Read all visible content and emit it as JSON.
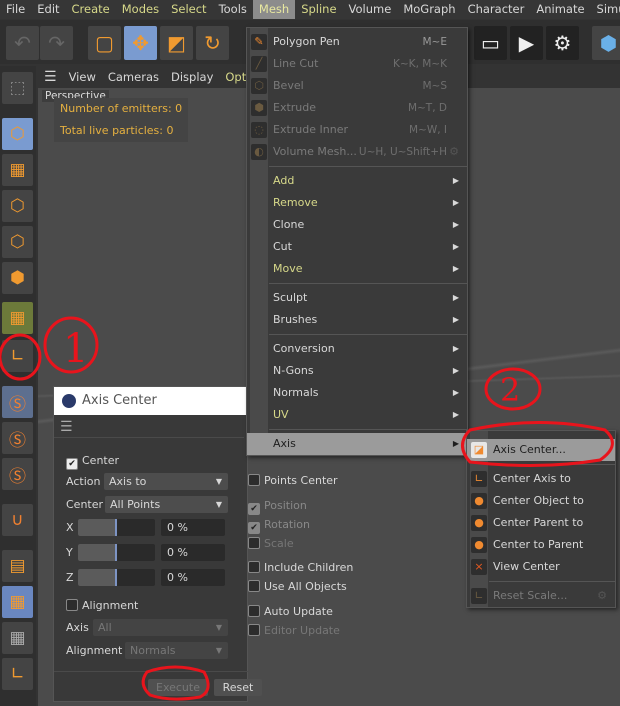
{
  "menubar": [
    {
      "label": "File",
      "yellow": false
    },
    {
      "label": "Edit",
      "yellow": false
    },
    {
      "label": "Create",
      "yellow": true
    },
    {
      "label": "Modes",
      "yellow": true
    },
    {
      "label": "Select",
      "yellow": true
    },
    {
      "label": "Tools",
      "yellow": false
    },
    {
      "label": "Mesh",
      "yellow": true,
      "active": true
    },
    {
      "label": "Spline",
      "yellow": true
    },
    {
      "label": "Volume",
      "yellow": false
    },
    {
      "label": "MoGraph",
      "yellow": false
    },
    {
      "label": "Character",
      "yellow": false
    },
    {
      "label": "Animate",
      "yellow": false
    },
    {
      "label": "Simulate",
      "yellow": false
    }
  ],
  "viewport": {
    "menu": [
      "View",
      "Cameras",
      "Display",
      "Options"
    ],
    "camera": "Perspective",
    "hud": {
      "emitters": "Number of emitters: 0",
      "particles": "Total live particles: 0"
    }
  },
  "mesh_menu": [
    {
      "label": "Polygon Pen",
      "shortcut": "M~E",
      "icon": "polygon-pen-icon"
    },
    {
      "label": "Line Cut",
      "shortcut": "K~K, M~K",
      "disabled": true,
      "icon": "knife-icon"
    },
    {
      "label": "Bevel",
      "shortcut": "M~S",
      "disabled": true,
      "icon": "bevel-icon"
    },
    {
      "label": "Extrude",
      "shortcut": "M~T, D",
      "disabled": true,
      "icon": "extrude-icon"
    },
    {
      "label": "Extrude Inner",
      "shortcut": "M~W, I",
      "disabled": true,
      "icon": "extrude-inner-icon"
    },
    {
      "label": "Volume Mesh...",
      "shortcut": "U~H, U~Shift+H",
      "disabled": true,
      "icon": "volume-mesh-icon",
      "gear": true
    },
    {
      "sep": true
    },
    {
      "label": "Add",
      "sub": true,
      "yellow": true
    },
    {
      "label": "Remove",
      "sub": true,
      "yellow": true
    },
    {
      "label": "Clone",
      "sub": true
    },
    {
      "label": "Cut",
      "sub": true
    },
    {
      "label": "Move",
      "sub": true,
      "yellow": true
    },
    {
      "sep": true
    },
    {
      "label": "Sculpt",
      "sub": true
    },
    {
      "label": "Brushes",
      "sub": true
    },
    {
      "sep": true
    },
    {
      "label": "Conversion",
      "sub": true
    },
    {
      "label": "N-Gons",
      "sub": true
    },
    {
      "label": "Normals",
      "sub": true
    },
    {
      "label": "UV",
      "sub": true,
      "yellow": true
    },
    {
      "sep": true
    },
    {
      "label": "Axis",
      "sub": true,
      "highlight": true
    }
  ],
  "axis_submenu": [
    {
      "label": "Axis Center...",
      "highlight": true,
      "icon": "axis-center-icon"
    },
    {
      "sep": true
    },
    {
      "label": "Center Axis to",
      "icon": "center-axis-icon"
    },
    {
      "label": "Center Object to",
      "icon": "center-object-icon"
    },
    {
      "label": "Center Parent to",
      "icon": "center-parent-icon"
    },
    {
      "label": "Center to Parent",
      "icon": "center-to-parent-icon"
    },
    {
      "label": "View Center",
      "icon": "view-center-icon"
    },
    {
      "sep": true
    },
    {
      "label": "Reset Scale...",
      "disabled": true,
      "icon": "reset-scale-icon",
      "gear": true
    }
  ],
  "dialog": {
    "title": "Axis Center",
    "center": {
      "label": "Center",
      "checked": true
    },
    "action": {
      "label": "Action",
      "value": "Axis to"
    },
    "center_mode": {
      "label": "Center",
      "value": "All Points"
    },
    "x": {
      "label": "X",
      "value": "0 %",
      "fraction": 0.5
    },
    "y": {
      "label": "Y",
      "value": "0 %",
      "fraction": 0.5
    },
    "z": {
      "label": "Z",
      "value": "0 %",
      "fraction": 0.5
    },
    "alignment_cb": {
      "label": "Alignment",
      "checked": false
    },
    "axis": {
      "label": "Axis",
      "value": "All"
    },
    "alignment": {
      "label": "Alignment",
      "value": "Normals"
    },
    "points_center": "Points Center",
    "position": "Position",
    "rotation": "Rotation",
    "scale": "Scale",
    "include_children": "Include Children",
    "use_all_objects": "Use All Objects",
    "auto_update": "Auto Update",
    "editor_update": "Editor Update",
    "execute": "Execute",
    "reset": "Reset"
  },
  "annotations": {
    "step1": "1",
    "step2": "2",
    "color": "#e8141c"
  }
}
